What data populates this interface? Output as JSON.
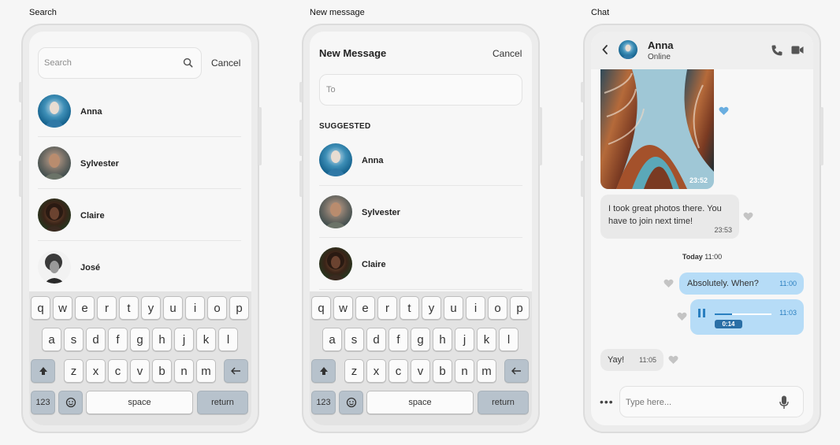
{
  "frames": {
    "search_label": "Search",
    "new_message_label": "New message",
    "chat_label": "Chat"
  },
  "search": {
    "placeholder": "Search",
    "cancel": "Cancel",
    "contacts": [
      {
        "name": "Anna"
      },
      {
        "name": "Sylvester"
      },
      {
        "name": "Claire"
      },
      {
        "name": "José"
      }
    ]
  },
  "new_message": {
    "title": "New Message",
    "cancel": "Cancel",
    "to_placeholder": "To",
    "suggested_label": "SUGGESTED",
    "contacts": [
      {
        "name": "Anna"
      },
      {
        "name": "Sylvester"
      },
      {
        "name": "Claire"
      }
    ]
  },
  "keyboard": {
    "row1": [
      "q",
      "w",
      "e",
      "r",
      "t",
      "y",
      "u",
      "i",
      "o",
      "p"
    ],
    "row2": [
      "a",
      "s",
      "d",
      "f",
      "g",
      "h",
      "j",
      "k",
      "l"
    ],
    "row3": [
      "z",
      "x",
      "c",
      "v",
      "b",
      "n",
      "m"
    ],
    "numbers": "123",
    "space": "space",
    "return": "return"
  },
  "chat": {
    "contact_name": "Anna",
    "status": "Online",
    "photo_time": "23:52",
    "msg1_text": "I took great photos there. You have to join next time!",
    "msg1_time": "23:53",
    "day_label": "Today",
    "day_time": "11:00",
    "msg2_text": "Absolutely. When?",
    "msg2_time": "11:00",
    "voice_time": "11:03",
    "voice_duration": "0:14",
    "msg3_text": "Yay!",
    "msg3_time": "11:05",
    "composer_placeholder": "Type here...",
    "more": "•••"
  },
  "colors": {
    "outgoing_bubble": "#b6dcf7",
    "incoming_bubble": "#e9e9e9",
    "accent": "#2a7fc0",
    "key_dark": "#b7c2cc"
  }
}
